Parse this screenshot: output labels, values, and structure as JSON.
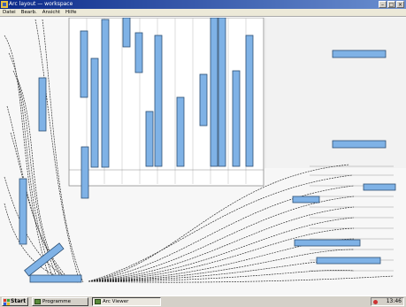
{
  "window": {
    "title": "Arc layout — workspace"
  },
  "menu": {
    "items": [
      "Datei",
      "Bearb.",
      "Ansicht",
      "Hilfe"
    ]
  },
  "taskbar": {
    "start_label": "Start",
    "tasks": [
      {
        "label": "Programme"
      },
      {
        "label": "Arc Viewer"
      }
    ],
    "clock": "13:46"
  },
  "colors": {
    "accent": "#7fb2e6",
    "bar_border": "#2d4f73",
    "curve": "#333333"
  }
}
